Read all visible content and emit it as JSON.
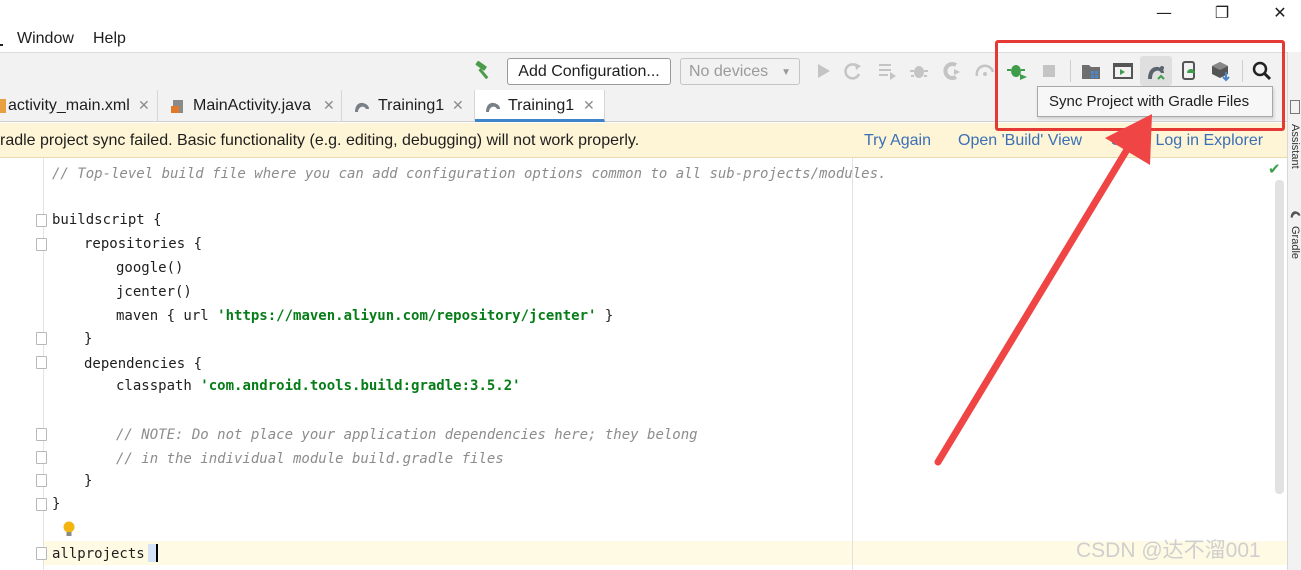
{
  "window_controls": {
    "minimize": "—",
    "restore": "❐",
    "close": "✕"
  },
  "menu": {
    "window_label": "Window",
    "help_label": "Help"
  },
  "toolbar": {
    "config_label": "Add Configuration...",
    "device_label": "No devices",
    "icons": [
      "build-hammer-icon",
      "run-icon",
      "apply-changes-icon",
      "coverage-icon",
      "debug-icon",
      "profile-icon",
      "attach-debugger-icon",
      "stop-icon",
      "project-structure-icon",
      "terminal-icon",
      "gradle-sync-icon",
      "avd-manager-icon",
      "sdk-manager-icon",
      "search-icon"
    ]
  },
  "tabs": [
    {
      "label": "activity_main.xml",
      "close": "✕"
    },
    {
      "label": "MainActivity.java",
      "close": "✕"
    },
    {
      "label": "Training1",
      "close": "✕"
    },
    {
      "label": "Training1",
      "close": "✕"
    }
  ],
  "notification": {
    "message": "radle project sync failed. Basic functionality (e.g. editing, debugging) will not work properly.",
    "links": [
      "Try Again",
      "Open 'Build' View",
      "Show Log in Explorer"
    ]
  },
  "tooltip": {
    "text": "Sync Project with Gradle Files"
  },
  "editor": {
    "lines": [
      {
        "indent": 0,
        "parts": [
          {
            "t": "cmt",
            "v": "// Top-level build file where you can add configuration options common to all sub-projects/modules."
          }
        ]
      },
      {
        "indent": 0,
        "parts": []
      },
      {
        "indent": 0,
        "parts": [
          {
            "t": "txt",
            "v": "buildscript {"
          }
        ]
      },
      {
        "indent": 1,
        "parts": [
          {
            "t": "txt",
            "v": "repositories {"
          }
        ]
      },
      {
        "indent": 2,
        "parts": [
          {
            "t": "txt",
            "v": "google()"
          }
        ]
      },
      {
        "indent": 2,
        "parts": [
          {
            "t": "txt",
            "v": "jcenter()"
          }
        ]
      },
      {
        "indent": 2,
        "parts": [
          {
            "t": "txt",
            "v": "maven { url "
          },
          {
            "t": "str",
            "v": "'https://maven.aliyun.com/repository/jcenter'"
          },
          {
            "t": "txt",
            "v": " }"
          }
        ]
      },
      {
        "indent": 1,
        "parts": [
          {
            "t": "txt",
            "v": "}"
          }
        ]
      },
      {
        "indent": 1,
        "parts": [
          {
            "t": "txt",
            "v": "dependencies {"
          }
        ]
      },
      {
        "indent": 2,
        "parts": [
          {
            "t": "txt",
            "v": "classpath "
          },
          {
            "t": "str",
            "v": "'com.android.tools.build:gradle:3.5.2'"
          }
        ]
      },
      {
        "indent": 0,
        "parts": []
      },
      {
        "indent": 2,
        "parts": [
          {
            "t": "cmt",
            "v": "// NOTE: Do not place your application dependencies here; they belong"
          }
        ]
      },
      {
        "indent": 2,
        "parts": [
          {
            "t": "cmt",
            "v": "// in the individual module build.gradle files"
          }
        ]
      },
      {
        "indent": 1,
        "parts": [
          {
            "t": "txt",
            "v": "}"
          }
        ]
      },
      {
        "indent": 0,
        "parts": [
          {
            "t": "txt",
            "v": "}"
          }
        ]
      },
      {
        "indent": 0,
        "parts": []
      },
      {
        "indent": 0,
        "parts": [
          {
            "t": "txt",
            "v": "allprojects "
          }
        ]
      }
    ],
    "status_check": "✔"
  },
  "sidebar": {
    "assistant_label": "Assistant",
    "gradle_label": "Gradle"
  },
  "watermark": "CSDN @达不溜001",
  "colors": {
    "annotation_red": "#e53935",
    "link_blue": "#3b6fb6",
    "warning_bg": "#fdf5d6",
    "string_green": "#067d17",
    "comment_gray": "#8c8c8c"
  }
}
